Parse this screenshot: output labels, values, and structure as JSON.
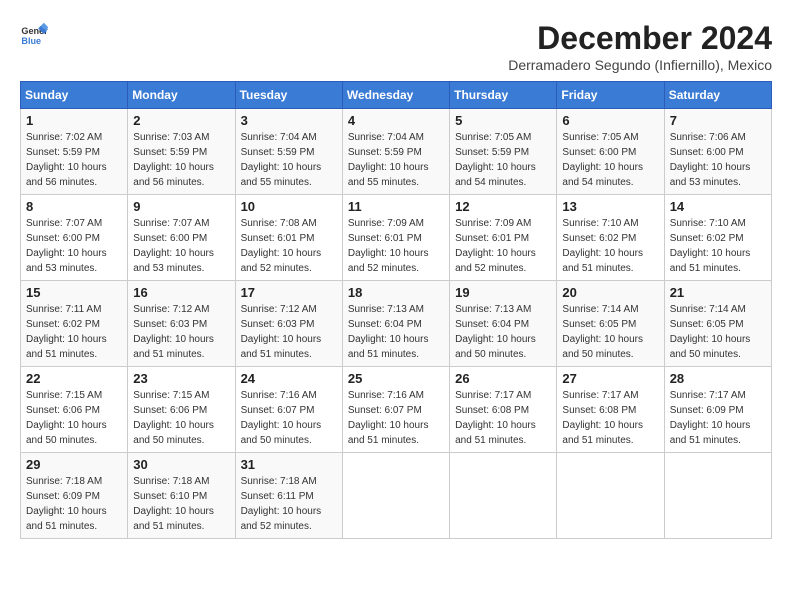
{
  "logo": {
    "line1": "General",
    "line2": "Blue"
  },
  "title": "December 2024",
  "subtitle": "Derramadero Segundo (Infiernillo), Mexico",
  "weekdays": [
    "Sunday",
    "Monday",
    "Tuesday",
    "Wednesday",
    "Thursday",
    "Friday",
    "Saturday"
  ],
  "weeks": [
    [
      {
        "day": "1",
        "sunrise": "Sunrise: 7:02 AM",
        "sunset": "Sunset: 5:59 PM",
        "daylight": "Daylight: 10 hours and 56 minutes."
      },
      {
        "day": "2",
        "sunrise": "Sunrise: 7:03 AM",
        "sunset": "Sunset: 5:59 PM",
        "daylight": "Daylight: 10 hours and 56 minutes."
      },
      {
        "day": "3",
        "sunrise": "Sunrise: 7:04 AM",
        "sunset": "Sunset: 5:59 PM",
        "daylight": "Daylight: 10 hours and 55 minutes."
      },
      {
        "day": "4",
        "sunrise": "Sunrise: 7:04 AM",
        "sunset": "Sunset: 5:59 PM",
        "daylight": "Daylight: 10 hours and 55 minutes."
      },
      {
        "day": "5",
        "sunrise": "Sunrise: 7:05 AM",
        "sunset": "Sunset: 5:59 PM",
        "daylight": "Daylight: 10 hours and 54 minutes."
      },
      {
        "day": "6",
        "sunrise": "Sunrise: 7:05 AM",
        "sunset": "Sunset: 6:00 PM",
        "daylight": "Daylight: 10 hours and 54 minutes."
      },
      {
        "day": "7",
        "sunrise": "Sunrise: 7:06 AM",
        "sunset": "Sunset: 6:00 PM",
        "daylight": "Daylight: 10 hours and 53 minutes."
      }
    ],
    [
      {
        "day": "8",
        "sunrise": "Sunrise: 7:07 AM",
        "sunset": "Sunset: 6:00 PM",
        "daylight": "Daylight: 10 hours and 53 minutes."
      },
      {
        "day": "9",
        "sunrise": "Sunrise: 7:07 AM",
        "sunset": "Sunset: 6:00 PM",
        "daylight": "Daylight: 10 hours and 53 minutes."
      },
      {
        "day": "10",
        "sunrise": "Sunrise: 7:08 AM",
        "sunset": "Sunset: 6:01 PM",
        "daylight": "Daylight: 10 hours and 52 minutes."
      },
      {
        "day": "11",
        "sunrise": "Sunrise: 7:09 AM",
        "sunset": "Sunset: 6:01 PM",
        "daylight": "Daylight: 10 hours and 52 minutes."
      },
      {
        "day": "12",
        "sunrise": "Sunrise: 7:09 AM",
        "sunset": "Sunset: 6:01 PM",
        "daylight": "Daylight: 10 hours and 52 minutes."
      },
      {
        "day": "13",
        "sunrise": "Sunrise: 7:10 AM",
        "sunset": "Sunset: 6:02 PM",
        "daylight": "Daylight: 10 hours and 51 minutes."
      },
      {
        "day": "14",
        "sunrise": "Sunrise: 7:10 AM",
        "sunset": "Sunset: 6:02 PM",
        "daylight": "Daylight: 10 hours and 51 minutes."
      }
    ],
    [
      {
        "day": "15",
        "sunrise": "Sunrise: 7:11 AM",
        "sunset": "Sunset: 6:02 PM",
        "daylight": "Daylight: 10 hours and 51 minutes."
      },
      {
        "day": "16",
        "sunrise": "Sunrise: 7:12 AM",
        "sunset": "Sunset: 6:03 PM",
        "daylight": "Daylight: 10 hours and 51 minutes."
      },
      {
        "day": "17",
        "sunrise": "Sunrise: 7:12 AM",
        "sunset": "Sunset: 6:03 PM",
        "daylight": "Daylight: 10 hours and 51 minutes."
      },
      {
        "day": "18",
        "sunrise": "Sunrise: 7:13 AM",
        "sunset": "Sunset: 6:04 PM",
        "daylight": "Daylight: 10 hours and 51 minutes."
      },
      {
        "day": "19",
        "sunrise": "Sunrise: 7:13 AM",
        "sunset": "Sunset: 6:04 PM",
        "daylight": "Daylight: 10 hours and 50 minutes."
      },
      {
        "day": "20",
        "sunrise": "Sunrise: 7:14 AM",
        "sunset": "Sunset: 6:05 PM",
        "daylight": "Daylight: 10 hours and 50 minutes."
      },
      {
        "day": "21",
        "sunrise": "Sunrise: 7:14 AM",
        "sunset": "Sunset: 6:05 PM",
        "daylight": "Daylight: 10 hours and 50 minutes."
      }
    ],
    [
      {
        "day": "22",
        "sunrise": "Sunrise: 7:15 AM",
        "sunset": "Sunset: 6:06 PM",
        "daylight": "Daylight: 10 hours and 50 minutes."
      },
      {
        "day": "23",
        "sunrise": "Sunrise: 7:15 AM",
        "sunset": "Sunset: 6:06 PM",
        "daylight": "Daylight: 10 hours and 50 minutes."
      },
      {
        "day": "24",
        "sunrise": "Sunrise: 7:16 AM",
        "sunset": "Sunset: 6:07 PM",
        "daylight": "Daylight: 10 hours and 50 minutes."
      },
      {
        "day": "25",
        "sunrise": "Sunrise: 7:16 AM",
        "sunset": "Sunset: 6:07 PM",
        "daylight": "Daylight: 10 hours and 51 minutes."
      },
      {
        "day": "26",
        "sunrise": "Sunrise: 7:17 AM",
        "sunset": "Sunset: 6:08 PM",
        "daylight": "Daylight: 10 hours and 51 minutes."
      },
      {
        "day": "27",
        "sunrise": "Sunrise: 7:17 AM",
        "sunset": "Sunset: 6:08 PM",
        "daylight": "Daylight: 10 hours and 51 minutes."
      },
      {
        "day": "28",
        "sunrise": "Sunrise: 7:17 AM",
        "sunset": "Sunset: 6:09 PM",
        "daylight": "Daylight: 10 hours and 51 minutes."
      }
    ],
    [
      {
        "day": "29",
        "sunrise": "Sunrise: 7:18 AM",
        "sunset": "Sunset: 6:09 PM",
        "daylight": "Daylight: 10 hours and 51 minutes."
      },
      {
        "day": "30",
        "sunrise": "Sunrise: 7:18 AM",
        "sunset": "Sunset: 6:10 PM",
        "daylight": "Daylight: 10 hours and 51 minutes."
      },
      {
        "day": "31",
        "sunrise": "Sunrise: 7:18 AM",
        "sunset": "Sunset: 6:11 PM",
        "daylight": "Daylight: 10 hours and 52 minutes."
      },
      null,
      null,
      null,
      null
    ]
  ]
}
